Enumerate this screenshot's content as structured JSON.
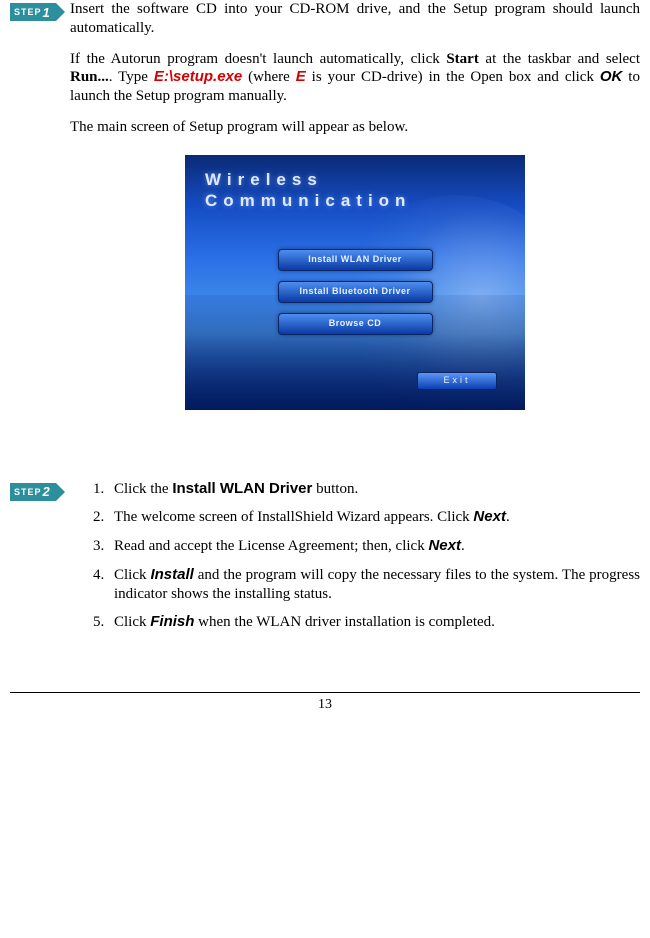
{
  "step1": {
    "tag_prefix": "STEP",
    "tag_num": "1",
    "p1": "Insert the software CD into your CD-ROM drive, and the Setup program should launch automatically.",
    "p2_a": "If the Autorun program doesn't launch automatically, click ",
    "p2_start": "Start",
    "p2_b": " at the taskbar and select ",
    "p2_run": "Run...",
    "p2_c": ".  Type ",
    "p2_cmd": "E:\\setup.exe",
    "p2_d": " (where ",
    "p2_E": "E",
    "p2_e": " is your CD-drive) in the Open box and click ",
    "p2_ok": "OK",
    "p2_f": " to launch the Setup program manually.",
    "p3": "The main screen of Setup program will appear as below."
  },
  "installer": {
    "title": "Wireless Communication",
    "btn1": "Install WLAN Driver",
    "btn2": "Install Bluetooth Driver",
    "btn3": "Browse  CD",
    "exit": "Exit"
  },
  "step2": {
    "tag_prefix": "STEP",
    "tag_num": "2",
    "i1_a": "Click the ",
    "i1_btn": "Install WLAN Driver",
    "i1_b": " button.",
    "i2_a": "The welcome screen of InstallShield Wizard appears. Click ",
    "i2_next": "Next",
    "i2_b": ".",
    "i3_a": "Read and accept the License Agreement; then, click ",
    "i3_next": "Next",
    "i3_b": ".",
    "i4_a": "Click ",
    "i4_install": "Install",
    "i4_b": " and the program will copy the necessary files to the system.  The progress indicator shows the installing status.",
    "i5_a": "Click ",
    "i5_finish": "Finish",
    "i5_b": " when the WLAN driver installation is completed."
  },
  "page_number": "13"
}
